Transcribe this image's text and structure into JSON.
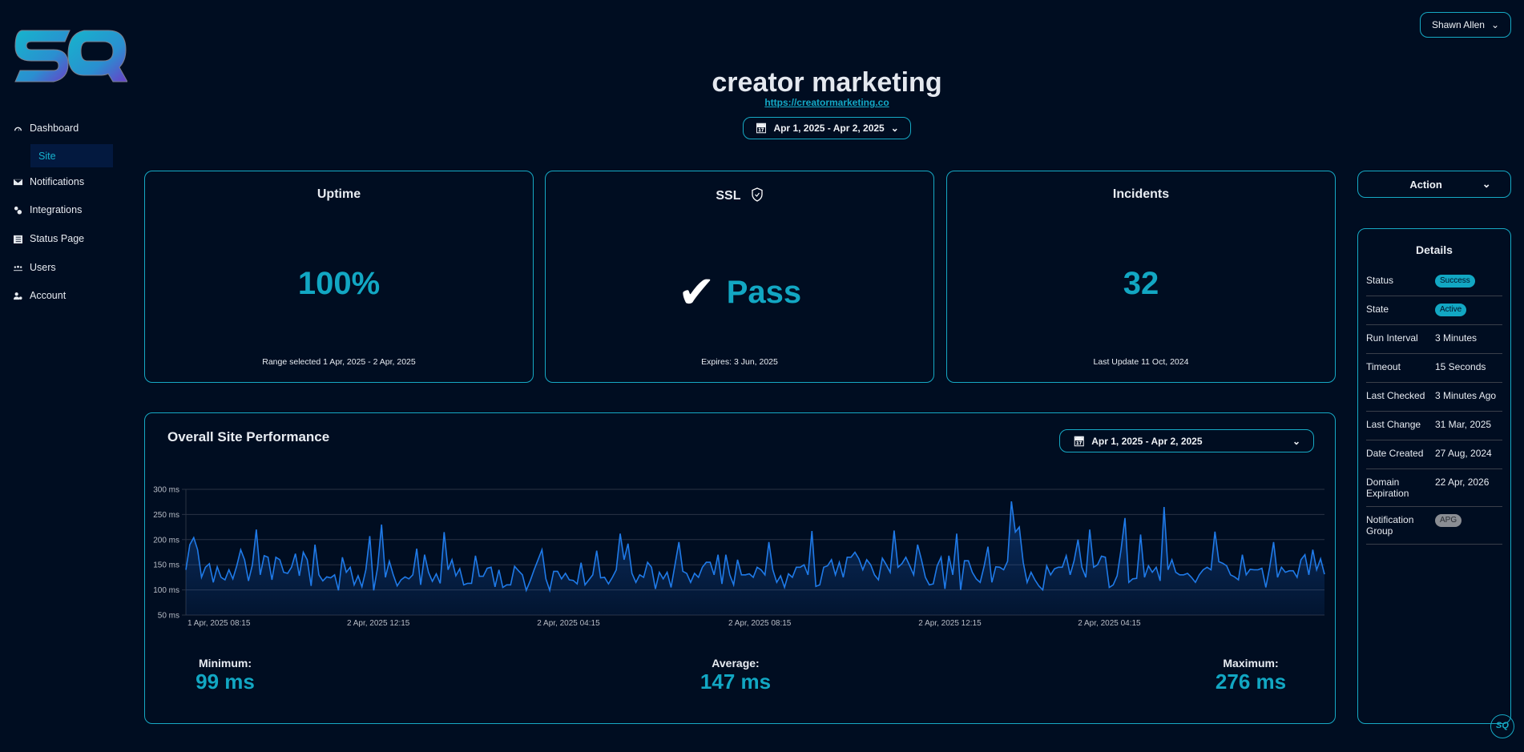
{
  "brand": {
    "logo_text": "SQ"
  },
  "user_menu": {
    "label": "Shawn Allen"
  },
  "sidebar": {
    "items": [
      {
        "label": "Dashboard",
        "icon": "gauge-icon"
      },
      {
        "label": "Site",
        "icon": ""
      },
      {
        "label": "Notifications",
        "icon": "envelope-icon"
      },
      {
        "label": "Integrations",
        "icon": "gears-icon"
      },
      {
        "label": "Status Page",
        "icon": "document-icon"
      },
      {
        "label": "Users",
        "icon": "users-icon"
      },
      {
        "label": "Account",
        "icon": "user-gear-icon"
      }
    ]
  },
  "header": {
    "title": "creator marketing",
    "url": "https://creatormarketing.co",
    "date_range": "Apr 1, 2025 - Apr 2, 2025"
  },
  "cards": {
    "uptime": {
      "title": "Uptime",
      "value": "100%",
      "footer": "Range selected 1 Apr, 2025 - 2 Apr, 2025"
    },
    "ssl": {
      "title": "SSL",
      "value": "Pass",
      "footer": "Expires: 3 Jun, 2025"
    },
    "incidents": {
      "title": "Incidents",
      "value": "32",
      "footer": "Last Update 11 Oct, 2024"
    }
  },
  "action": {
    "label": "Action"
  },
  "details": {
    "title": "Details",
    "rows": [
      {
        "label": "Status",
        "value": "Success",
        "type": "badge"
      },
      {
        "label": "State",
        "value": "Active",
        "type": "badge"
      },
      {
        "label": "Run Interval",
        "value": "3 Minutes"
      },
      {
        "label": "Timeout",
        "value": "15 Seconds"
      },
      {
        "label": "Last Checked",
        "value": "3 Minutes Ago"
      },
      {
        "label": "Last Change",
        "value": "31 Mar, 2025"
      },
      {
        "label": "Date Created",
        "value": "27 Aug, 2024"
      },
      {
        "label": "Domain Expiration",
        "value": "22 Apr, 2026"
      },
      {
        "label": "Notification Group",
        "value": "APG",
        "type": "grey-badge"
      }
    ]
  },
  "performance": {
    "title": "Overall Site Performance",
    "date_range": "Apr 1, 2025 - Apr 2, 2025",
    "stats": [
      {
        "label": "Minimum:",
        "value": "99 ms"
      },
      {
        "label": "Average:",
        "value": "147 ms"
      },
      {
        "label": "Maximum:",
        "value": "276 ms"
      }
    ]
  },
  "colors": {
    "accent": "#12a7c3",
    "line": "#1f7ae8",
    "bg": "#000d21"
  },
  "chart_data": {
    "type": "area",
    "ylabel": "ms",
    "ylim": [
      50,
      300
    ],
    "grid": true,
    "y_ticks": [
      {
        "value": 300,
        "label": "300 ms"
      },
      {
        "value": 250,
        "label": "250 ms"
      },
      {
        "value": 200,
        "label": "200 ms"
      },
      {
        "value": 150,
        "label": "150 ms"
      },
      {
        "value": 100,
        "label": "100 ms"
      },
      {
        "value": 50,
        "label": "50 ms"
      }
    ],
    "x_ticks": [
      {
        "label": "1 Apr, 2025 08:15",
        "pos": 0
      },
      {
        "label": "2 Apr, 2025 12:15",
        "pos": 0.14
      },
      {
        "label": "2 Apr, 2025 04:15",
        "pos": 0.307
      },
      {
        "label": "2 Apr, 2025 08:15",
        "pos": 0.475
      },
      {
        "label": "2 Apr, 2025 12:15",
        "pos": 0.642
      },
      {
        "label": "2 Apr, 2025 04:15",
        "pos": 0.782
      }
    ],
    "values": [
      140,
      190,
      204,
      180,
      125,
      145,
      152,
      115,
      146,
      125,
      120,
      140,
      122,
      148,
      180,
      160,
      118,
      150,
      220,
      130,
      168,
      165,
      120,
      165,
      160,
      135,
      133,
      145,
      172,
      128,
      175,
      160,
      108,
      190,
      130,
      118,
      126,
      124,
      130,
      99,
      165,
      135,
      145,
      110,
      128,
      106,
      140,
      207,
      99,
      145,
      230,
      125,
      157,
      130,
      108,
      120,
      126,
      122,
      130,
      182,
      110,
      170,
      135,
      117,
      132,
      113,
      215,
      140,
      160,
      128,
      142,
      110,
      113,
      113,
      168,
      127,
      127,
      143,
      145,
      106,
      140,
      105,
      110,
      110,
      147,
      138,
      130,
      99,
      118,
      140,
      160,
      180,
      122,
      99,
      137,
      137,
      122,
      133,
      120,
      119,
      112,
      154,
      110,
      120,
      130,
      178,
      124,
      125,
      112,
      125,
      140,
      212,
      160,
      192,
      133,
      115,
      130,
      125,
      155,
      145,
      102,
      135,
      122,
      135,
      105,
      150,
      195,
      137,
      133,
      115,
      133,
      125,
      145,
      155,
      155,
      130,
      170,
      112,
      170,
      130,
      110,
      160,
      130,
      130,
      132,
      125,
      145,
      140,
      130,
      195,
      140,
      115,
      128,
      105,
      132,
      125,
      145,
      145,
      150,
      130,
      217,
      107,
      110,
      145,
      148,
      160,
      130,
      155,
      125,
      165,
      165,
      175,
      162,
      140,
      160,
      150,
      130,
      120,
      163,
      150,
      135,
      218,
      145,
      152,
      165,
      148,
      130,
      190,
      160,
      125,
      110,
      112,
      148,
      165,
      102,
      168,
      130,
      212,
      100,
      158,
      158,
      135,
      122,
      115,
      147,
      186,
      115,
      146,
      145,
      140,
      157,
      276,
      215,
      225,
      155,
      115,
      135,
      120,
      108,
      100,
      148,
      130,
      142,
      145,
      145,
      168,
      130,
      158,
      200,
      145,
      125,
      220,
      145,
      150,
      167,
      165,
      105,
      110,
      128,
      180,
      243,
      115,
      122,
      123,
      210,
      125,
      148,
      135,
      145,
      118,
      265,
      140,
      160,
      135,
      130,
      130,
      133,
      125,
      115,
      130,
      140,
      145,
      140,
      216,
      156,
      153,
      148,
      130,
      126,
      120,
      170,
      130,
      141,
      140,
      140,
      143,
      105,
      145,
      195,
      125,
      145,
      135,
      138,
      138,
      125,
      160,
      170,
      130,
      180,
      140,
      162,
      131
    ]
  }
}
